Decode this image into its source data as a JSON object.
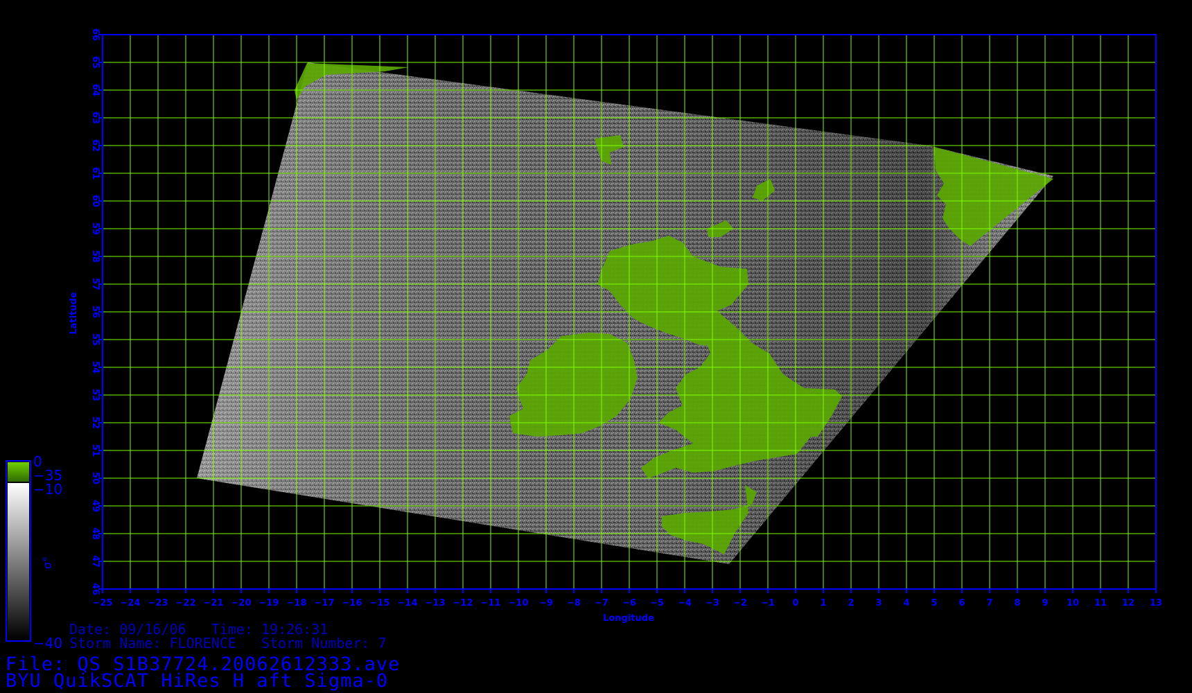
{
  "map": {
    "projection": "equirectangular",
    "lon_range": [
      -25,
      13
    ],
    "lat_range": [
      46,
      66
    ],
    "lon_ticks": [
      "-25",
      "-24",
      "-23",
      "-22",
      "-21",
      "-20",
      "-19",
      "-18",
      "-17",
      "-16",
      "-15",
      "-14",
      "-13",
      "-12",
      "-11",
      "-10",
      "-9",
      "-8",
      "-7",
      "-6",
      "-5",
      "-4",
      "-3",
      "-2",
      "-1",
      "0",
      "1",
      "2",
      "3",
      "4",
      "5",
      "6",
      "7",
      "8",
      "9",
      "10",
      "11",
      "12",
      "13"
    ],
    "lat_ticks": [
      "46",
      "47",
      "48",
      "49",
      "50",
      "51",
      "52",
      "53",
      "54",
      "55",
      "56",
      "57",
      "58",
      "59",
      "60",
      "61",
      "62",
      "63",
      "64",
      "65",
      "66"
    ],
    "xlabel": "Longitude",
    "ylabel": "Latitude",
    "grid": true,
    "swath_corners_lonlat": [
      [
        -17.6,
        65.0
      ],
      [
        4.8,
        62.0
      ],
      [
        9.3,
        60.9
      ],
      [
        -2.4,
        46.9
      ],
      [
        -21.6,
        50.0
      ]
    ],
    "colors": {
      "frame": "#0000ff",
      "grid": "#7fff00",
      "land": "#5aa800",
      "background": "#000000"
    }
  },
  "colorbar": {
    "symbol": "σ°",
    "labels": [
      "0",
      "−35",
      "−10",
      "−40"
    ],
    "land_segment": "0 to −35",
    "ocean_segment": "−10 to −40",
    "colors": {
      "top": "#6fcf00",
      "white": "#ffffff",
      "black": "#000000"
    }
  },
  "info": {
    "line1": "Date: 09/16/06   Time: 19:26:31",
    "line2": "Storm Name: FLORENCE   Storm Number: 7"
  },
  "titles": {
    "file": "File: QS_S1B37724.20062612333.ave",
    "main": "BYU QuikSCAT HiRes H aft Sigma-0"
  }
}
